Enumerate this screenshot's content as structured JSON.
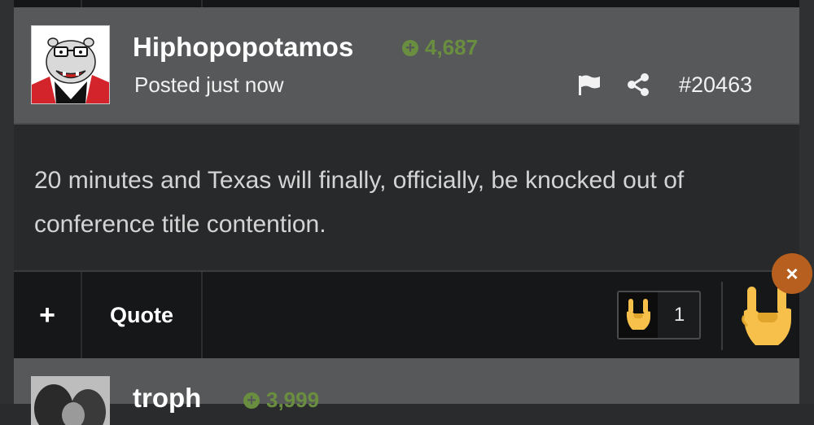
{
  "post": {
    "username": "Hiphopopotamos",
    "reputation": "4,687",
    "posted": "Posted just now",
    "post_number": "#20463",
    "body": "20 minutes and Texas will finally, officially, be knocked out of conference title contention.",
    "avatar_icon": "hippo-caricature-avatar",
    "flag_icon": "flag-icon",
    "share_icon": "share-icon"
  },
  "actions": {
    "plus_label": "+",
    "quote_label": "Quote",
    "reaction_count": "1",
    "reaction_icon": "rock-on-hand-emoji",
    "close_label": "×"
  },
  "next_post": {
    "username": "troph",
    "reputation": "3,999"
  },
  "colors": {
    "header_bg": "#575859",
    "body_bg": "#28292b",
    "action_bg": "#161719",
    "reputation_green": "#6a8e3f",
    "close_orange": "#b75f1e"
  }
}
